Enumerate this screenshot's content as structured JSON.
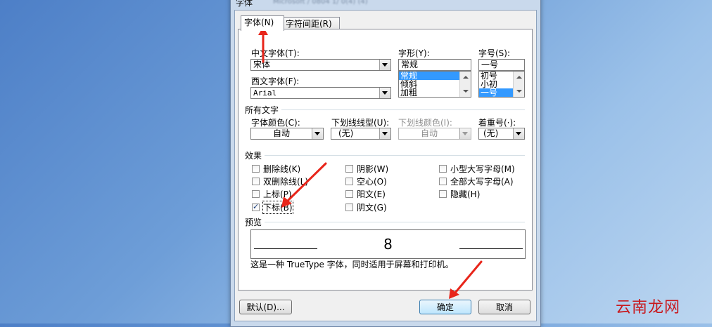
{
  "window": {
    "title": "字体",
    "title_blur": "Microsoft / 0804 1/ 0(4) (4)"
  },
  "tabs": [
    {
      "label": "字体(N)"
    },
    {
      "label": "字符间距(R)"
    }
  ],
  "font": {
    "chinese_font_label": "中文字体(T):",
    "chinese_font_value": "宋体",
    "western_font_label": "西文字体(F):",
    "western_font_value": "Arial",
    "style_label": "字形(Y):",
    "style_value": "常规",
    "style_options": [
      "常规",
      "倾斜",
      "加粗"
    ],
    "size_label": "字号(S):",
    "size_value": "一号",
    "size_options": [
      "初号",
      "小初",
      "一号"
    ]
  },
  "all_text": {
    "group_label": "所有文字",
    "color_label": "字体颜色(C):",
    "color_value": "自动",
    "underline_label": "下划线线型(U):",
    "underline_value": "(无)",
    "underline_color_label": "下划线颜色(I):",
    "underline_color_value": "自动",
    "emphasis_label": "着重号(·):",
    "emphasis_value": "(无)"
  },
  "effects": {
    "group_label": "效果",
    "items": [
      {
        "label": "删除线(K)",
        "checked": false
      },
      {
        "label": "双删除线(L)",
        "checked": false
      },
      {
        "label": "上标(P)",
        "checked": false
      },
      {
        "label": "下标(B)",
        "checked": true
      },
      {
        "label": "阴影(W)",
        "checked": false
      },
      {
        "label": "空心(O)",
        "checked": false
      },
      {
        "label": "阳文(E)",
        "checked": false
      },
      {
        "label": "阴文(G)",
        "checked": false
      },
      {
        "label": "小型大写字母(M)",
        "checked": false
      },
      {
        "label": "全部大写字母(A)",
        "checked": false
      },
      {
        "label": "隐藏(H)",
        "checked": false
      }
    ]
  },
  "preview": {
    "group_label": "预览",
    "sample": "8",
    "note": "这是一种 TrueType 字体，同时适用于屏幕和打印机。"
  },
  "buttons": {
    "default": "默认(D)...",
    "ok": "确定",
    "cancel": "取消"
  },
  "watermark": "云南龙网",
  "colors": {
    "accent_selection": "#3399ff",
    "arrow": "#e8251a"
  }
}
